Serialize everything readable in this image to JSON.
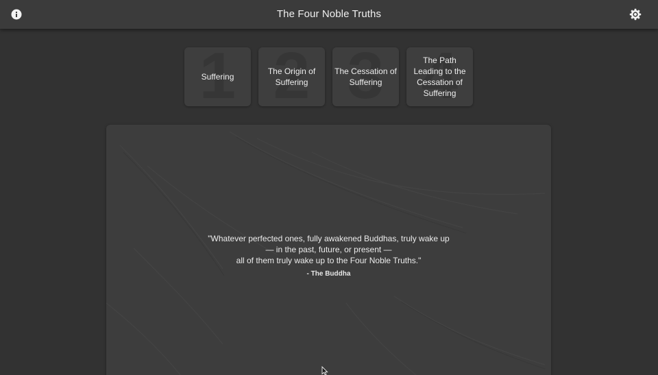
{
  "header": {
    "title": "The Four Noble Truths",
    "info_icon": "info-icon",
    "settings_icon": "gear-icon"
  },
  "truths": [
    {
      "number": "1",
      "label": "Suffering"
    },
    {
      "number": "2",
      "label": "The Origin of Suffering"
    },
    {
      "number": "3",
      "label": "The Cessation of Suffering"
    },
    {
      "number": "4",
      "label": "The Path Leading to the Cessation of Suffering"
    }
  ],
  "quote": {
    "lines": [
      "\"Whatever perfected ones, fully awakened Buddhas, truly wake up",
      "— in the past, future, or present —",
      "all of them truly wake up to the Four Noble Truths.\""
    ],
    "author": "- The Buddha"
  },
  "colors": {
    "background": "#323232",
    "topbar": "#3b3b3b",
    "card": "#3e3e3e",
    "panel": "#3d3d3d",
    "text": "#ececec"
  }
}
